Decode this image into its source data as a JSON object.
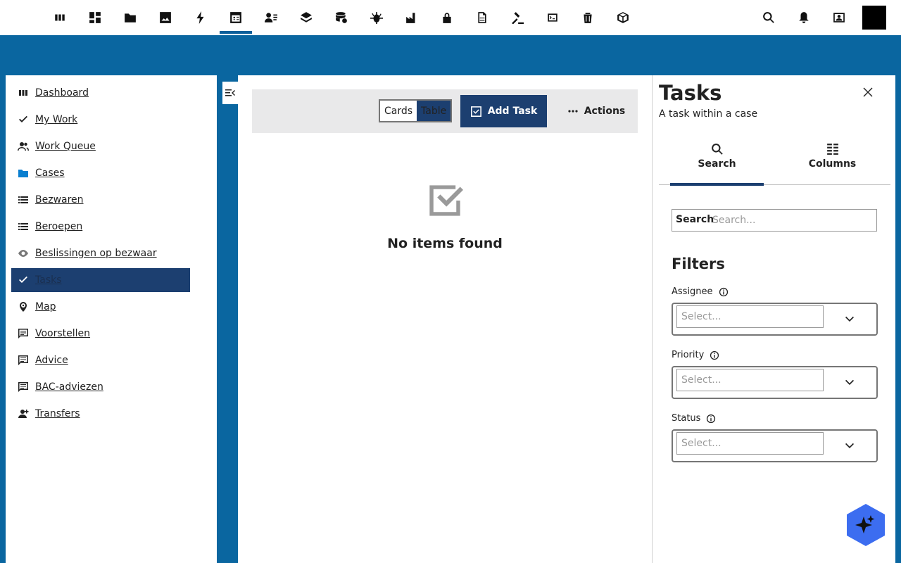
{
  "topbar": {
    "icons": [
      "dashboard-icon",
      "grid-icon",
      "folder-icon",
      "image-icon",
      "bolt-icon",
      "table-icon",
      "person-list-icon",
      "layers-icon",
      "database-sync-icon",
      "bug-icon",
      "factory-icon",
      "lock-icon",
      "document-icon",
      "gavel-icon",
      "code-icon",
      "bin-icon",
      "box-icon"
    ],
    "active_index": 5,
    "right_icons": [
      "search-icon",
      "bell-icon",
      "contact-icon"
    ]
  },
  "nav": {
    "items": [
      {
        "label": "Dashboard",
        "icon": "dashboard-icon"
      },
      {
        "label": "My Work",
        "icon": "check-icon"
      },
      {
        "label": "Work Queue",
        "icon": "people-icon"
      },
      {
        "label": "Cases",
        "icon": "folder-icon"
      },
      {
        "label": "Bezwaren",
        "icon": "list-icon"
      },
      {
        "label": "Beroepen",
        "icon": "list-icon"
      },
      {
        "label": "Beslissingen op bezwaar",
        "icon": "eye-icon"
      },
      {
        "label": "Tasks",
        "icon": "check-icon"
      },
      {
        "label": "Map",
        "icon": "pin-icon"
      },
      {
        "label": "Voorstellen",
        "icon": "comment-icon"
      },
      {
        "label": "Advice",
        "icon": "comment-icon"
      },
      {
        "label": "BAC-adviezen",
        "icon": "comment-icon"
      },
      {
        "label": "Transfers",
        "icon": "person-add-icon"
      }
    ],
    "active_index": 7
  },
  "main": {
    "view_cards": "Cards",
    "view_table": "Table",
    "add_task": "Add Task",
    "actions": "Actions",
    "empty": "No items found"
  },
  "panel": {
    "title": "Tasks",
    "subtitle": "A task within a case",
    "tab_search": "Search",
    "tab_columns": "Columns",
    "search_label": "Search",
    "search_placeholder": "Search...",
    "filters_title": "Filters",
    "filters": [
      {
        "label": "Assignee",
        "placeholder": "Select..."
      },
      {
        "label": "Priority",
        "placeholder": "Select..."
      },
      {
        "label": "Status",
        "placeholder": "Select..."
      }
    ]
  },
  "colors": {
    "brand_blue": "#0a66a0",
    "accent_navy": "#1c3f70",
    "ai_button": "#3c6df0"
  }
}
